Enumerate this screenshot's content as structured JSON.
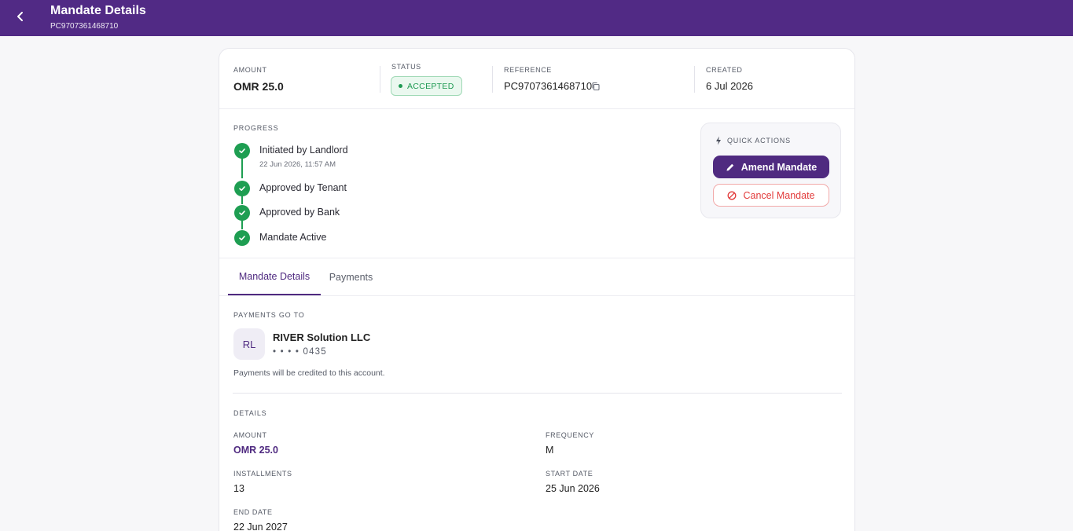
{
  "header": {
    "title": "Mandate Details",
    "subtitle": "PC9707361468710"
  },
  "summary": {
    "amount_label": "AMOUNT",
    "amount_value": "OMR 25.0",
    "status_label": "STATUS",
    "status_value": "ACCEPTED",
    "reference_label": "REFERENCE",
    "reference_value": "PC9707361468710",
    "created_label": "CREATED",
    "created_value": "6 Jul 2026"
  },
  "progress": {
    "label": "PROGRESS",
    "steps": [
      {
        "label": "Initiated by Landlord",
        "time": "22 Jun 2026, 11:57 AM"
      },
      {
        "label": "Approved by Tenant"
      },
      {
        "label": "Approved by Bank"
      },
      {
        "label": "Mandate Active"
      }
    ]
  },
  "quick_actions": {
    "title": "QUICK ACTIONS",
    "amend_label": "Amend Mandate",
    "cancel_label": "Cancel Mandate"
  },
  "tabs": [
    {
      "label": "Mandate Details",
      "active": true
    },
    {
      "label": "Payments",
      "active": false
    }
  ],
  "payee": {
    "section_label": "PAYMENTS GO TO",
    "initials": "RL",
    "name": "RIVER Solution LLC",
    "account": "• • • •  0435",
    "note": "Payments will be credited to this account."
  },
  "details": {
    "section_label": "DETAILS",
    "amount_label": "AMOUNT",
    "amount_value": "OMR 25.0",
    "frequency_label": "FREQUENCY",
    "frequency_value": "M",
    "installments_label": "INSTALLMENTS",
    "installments_value": "13",
    "start_label": "START DATE",
    "start_value": "25 Jun 2026",
    "end_label": "END DATE",
    "end_value": "22 Jun 2027"
  },
  "colors": {
    "brand": "#512a85",
    "success": "#1e9e52",
    "danger": "#e23b3b"
  }
}
